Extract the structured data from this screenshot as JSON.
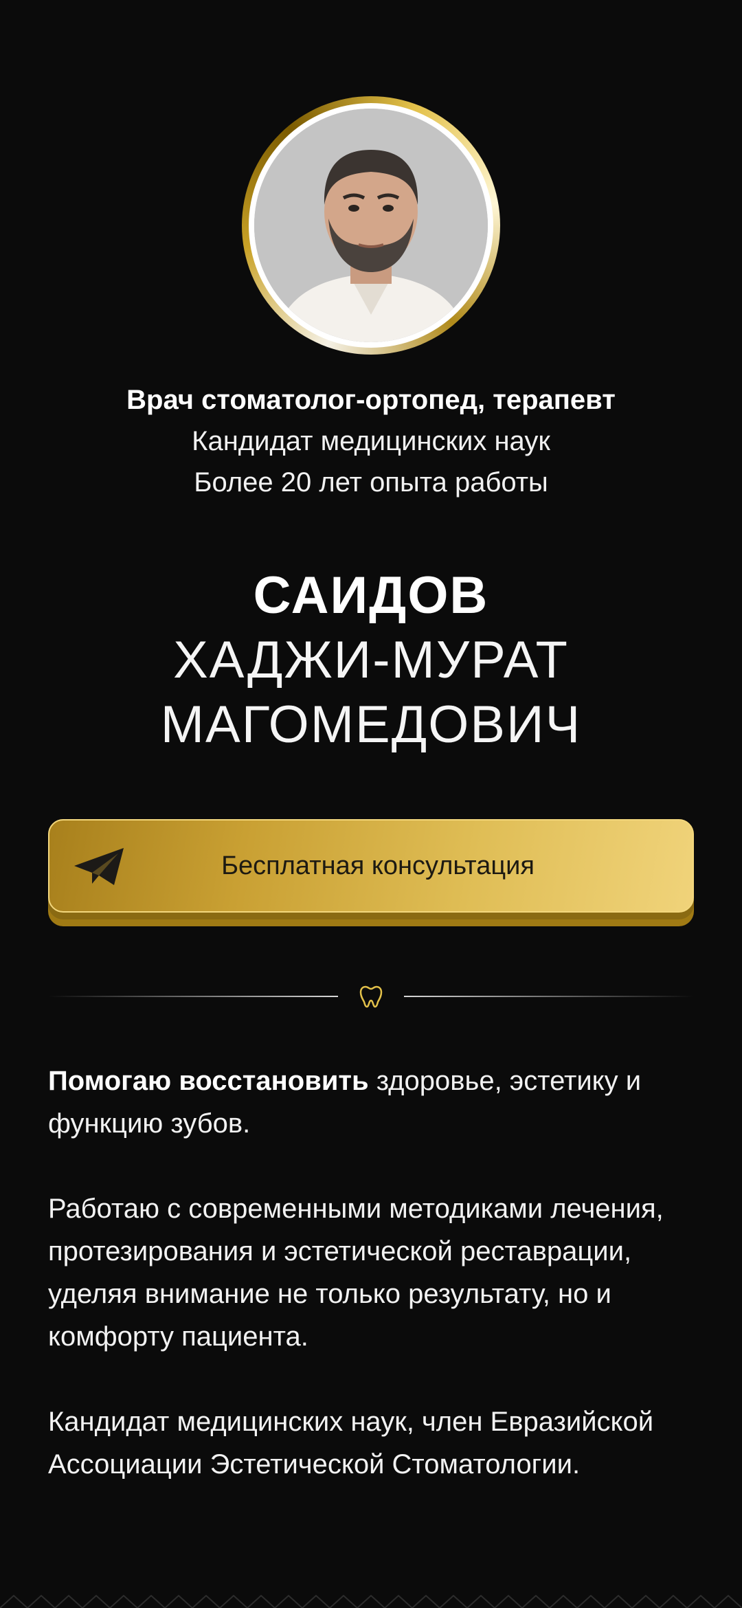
{
  "profile": {
    "photo_alt": "doctor-portrait"
  },
  "credentials": {
    "role": "Врач стоматолог-ортопед, терапевт",
    "degree": "Кандидат медицинских наук",
    "experience": "Более 20 лет опыта работы"
  },
  "name": {
    "surname": "САИДОВ",
    "first_name": "ХАДЖИ-МУРАТ",
    "patronymic": "МАГОМЕДОВИЧ"
  },
  "cta": {
    "label": "Бесплатная консультация",
    "icon": "telegram-icon"
  },
  "divider": {
    "icon": "tooth-icon"
  },
  "about": {
    "p1_bold": "Помогаю восстановить",
    "p1_rest": " здоровье, эстетику и функцию зубов.",
    "p2": "Работаю с современными методиками лечения, протезирования и эстетической реставрации, уделяя внимание не только результату, но и комфорту пациента.",
    "p3": "Кандидат медицинских наук, член Евразийской Ассоциации Эстетической Стоматологии."
  },
  "colors": {
    "background": "#0b0b0b",
    "accent_gold": "#dfbd55",
    "text": "#ffffff"
  }
}
